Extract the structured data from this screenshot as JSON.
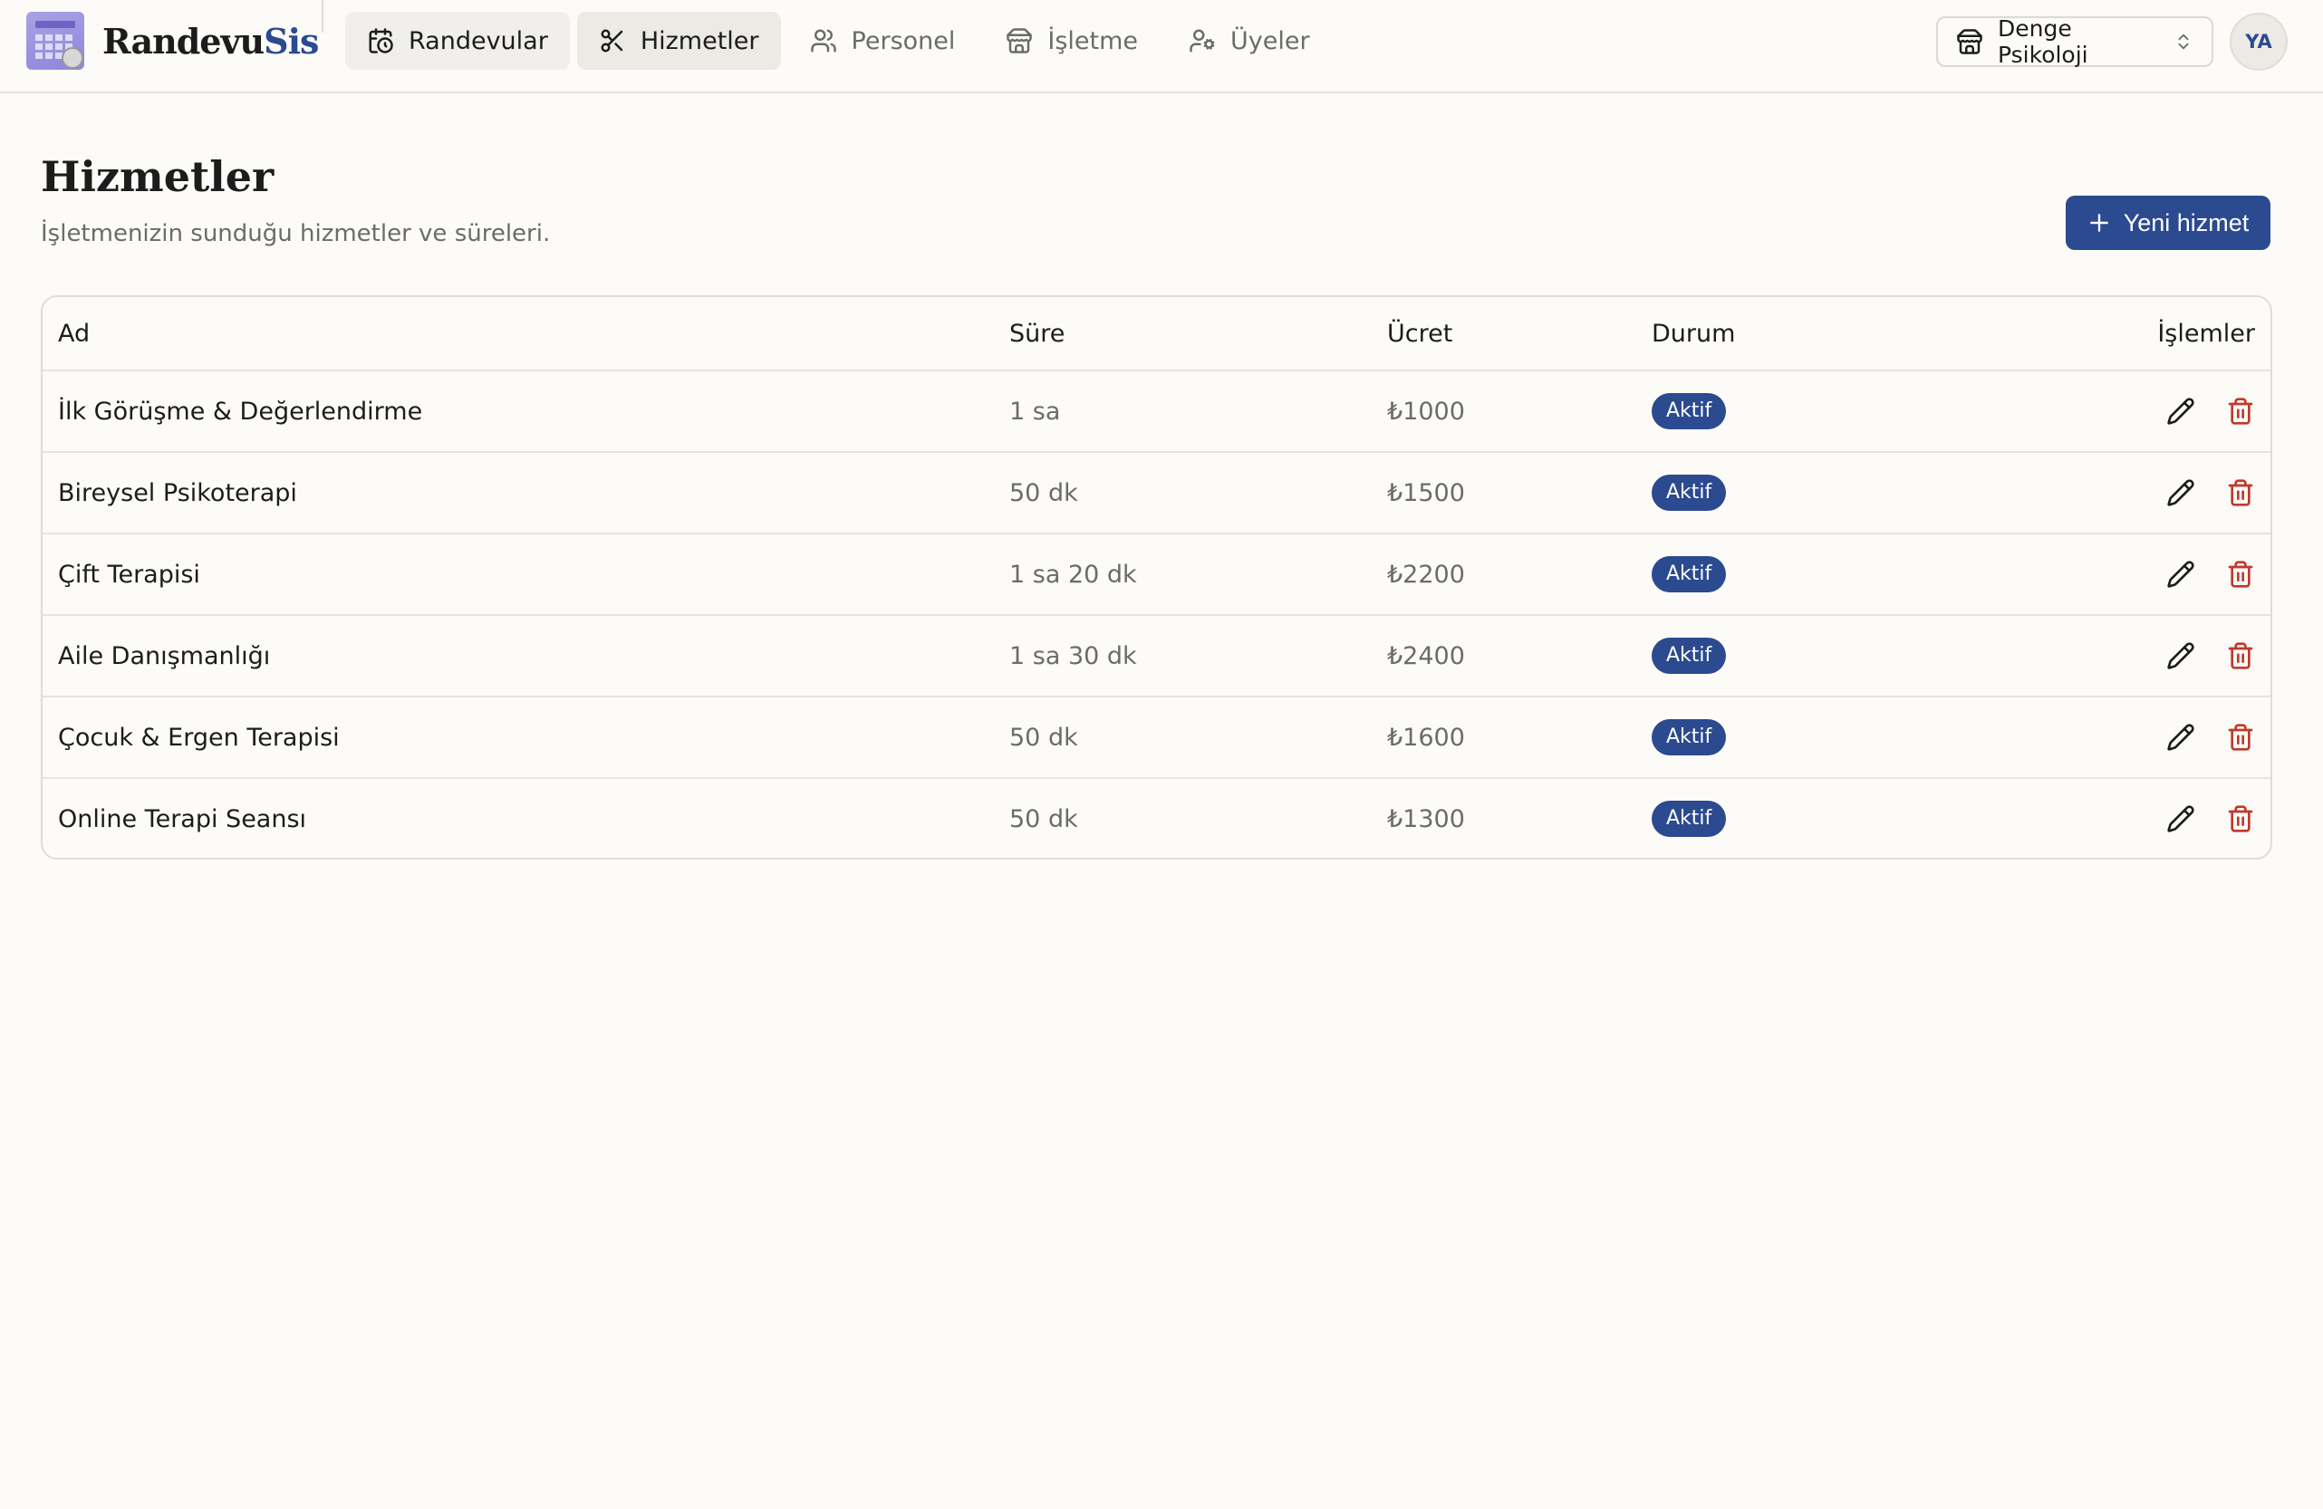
{
  "brand": {
    "name_part1": "Randevu",
    "name_part2": "Sis"
  },
  "nav": [
    {
      "label": "Randevular",
      "icon": "calendar-clock-icon"
    },
    {
      "label": "Hizmetler",
      "icon": "scissors-icon"
    },
    {
      "label": "Personel",
      "icon": "users-icon"
    },
    {
      "label": "İşletme",
      "icon": "store-icon"
    },
    {
      "label": "Üyeler",
      "icon": "user-cog-icon"
    }
  ],
  "business_selector": {
    "value": "Denge Psikoloji",
    "icon": "store-icon"
  },
  "user": {
    "initials": "YA"
  },
  "page": {
    "title": "Hizmetler",
    "subtitle": "İşletmenizin sunduğu hizmetler ve süreleri.",
    "new_button_label": "Yeni hizmet"
  },
  "table": {
    "columns": {
      "name": "Ad",
      "duration": "Süre",
      "fee": "Ücret",
      "status": "Durum",
      "actions": "İşlemler"
    },
    "rows": [
      {
        "name": "İlk Görüşme & Değerlendirme",
        "duration": "1 sa",
        "fee": "₺1000",
        "status": "Aktif"
      },
      {
        "name": "Bireysel Psikoterapi",
        "duration": "50 dk",
        "fee": "₺1500",
        "status": "Aktif"
      },
      {
        "name": "Çift Terapisi",
        "duration": "1 sa 20 dk",
        "fee": "₺2200",
        "status": "Aktif"
      },
      {
        "name": "Aile Danışmanlığı",
        "duration": "1 sa 30 dk",
        "fee": "₺2400",
        "status": "Aktif"
      },
      {
        "name": "Çocuk & Ergen Terapisi",
        "duration": "50 dk",
        "fee": "₺1600",
        "status": "Aktif"
      },
      {
        "name": "Online Terapi Seansı",
        "duration": "50 dk",
        "fee": "₺1300",
        "status": "Aktif"
      }
    ]
  },
  "colors": {
    "accent": "#2b4a8f",
    "danger": "#c0392b",
    "background": "#fcfbf8"
  }
}
